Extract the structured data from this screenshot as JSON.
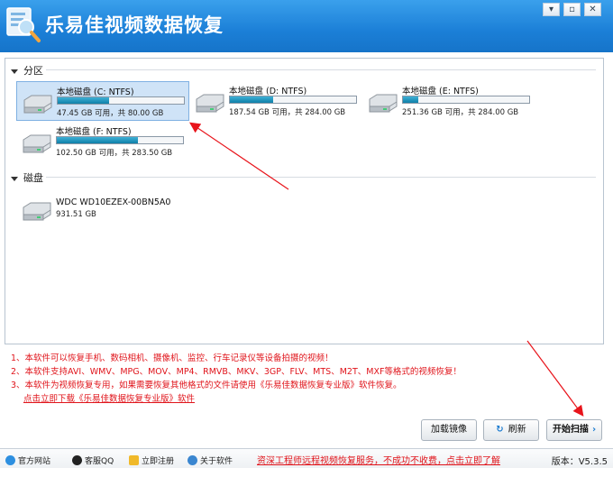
{
  "window": {
    "title": "乐易佳视频数据恢复",
    "buttons": [
      "▾",
      "▫",
      "✕"
    ]
  },
  "partitions": {
    "header": "分区",
    "items": [
      {
        "name": "本地磁盘 (C: NTFS)",
        "info": "47.45 GB 可用，共 80.00 GB",
        "used_ratio": 0.41,
        "selected": true
      },
      {
        "name": "本地磁盘 (D: NTFS)",
        "info": "187.54 GB 可用，共 284.00 GB",
        "used_ratio": 0.34,
        "selected": false
      },
      {
        "name": "本地磁盘 (E: NTFS)",
        "info": "251.36 GB 可用，共 284.00 GB",
        "used_ratio": 0.12,
        "selected": false
      },
      {
        "name": "本地磁盘 (F: NTFS)",
        "info": "102.50 GB 可用，共 283.50 GB",
        "used_ratio": 0.64,
        "selected": false
      }
    ]
  },
  "disks": {
    "header": "磁盘",
    "items": [
      {
        "name": "WDC WD10EZEX-00BN5A0",
        "info": "931.51 GB"
      }
    ]
  },
  "notes": {
    "line1": "1、本软件可以恢复手机、数码相机、摄像机、监控、行车记录仪等设备拍摄的视频！",
    "line2": "2、本软件支持AVI、WMV、MPG、MOV、MP4、RMVB、MKV、3GP、FLV、MTS、M2T、MXF等格式的视频恢复！",
    "line3": "3、本软件为视频恢复专用，如果需要恢复其他格式的文件请使用《乐易佳数据恢复专业版》软件恢复。",
    "link": "点击立即下载《乐易佳数据恢复专业版》软件"
  },
  "buttons": {
    "load_image": "加载镜像",
    "refresh": "刷新",
    "start_scan": "开始扫描"
  },
  "statusbar": {
    "website": "官方网站",
    "qq": "客服QQ",
    "register": "立即注册",
    "about": "关于软件",
    "promo": "资深工程师远程视频恢复服务，不成功不收费，点击立即了解",
    "version": "版本：V5.3.5"
  },
  "colors": {
    "titlebar": "#1b7fd7",
    "note_red": "#e0141b",
    "bar_fill": "#0f7fa8",
    "selected_bg": "#cfe3f7"
  }
}
